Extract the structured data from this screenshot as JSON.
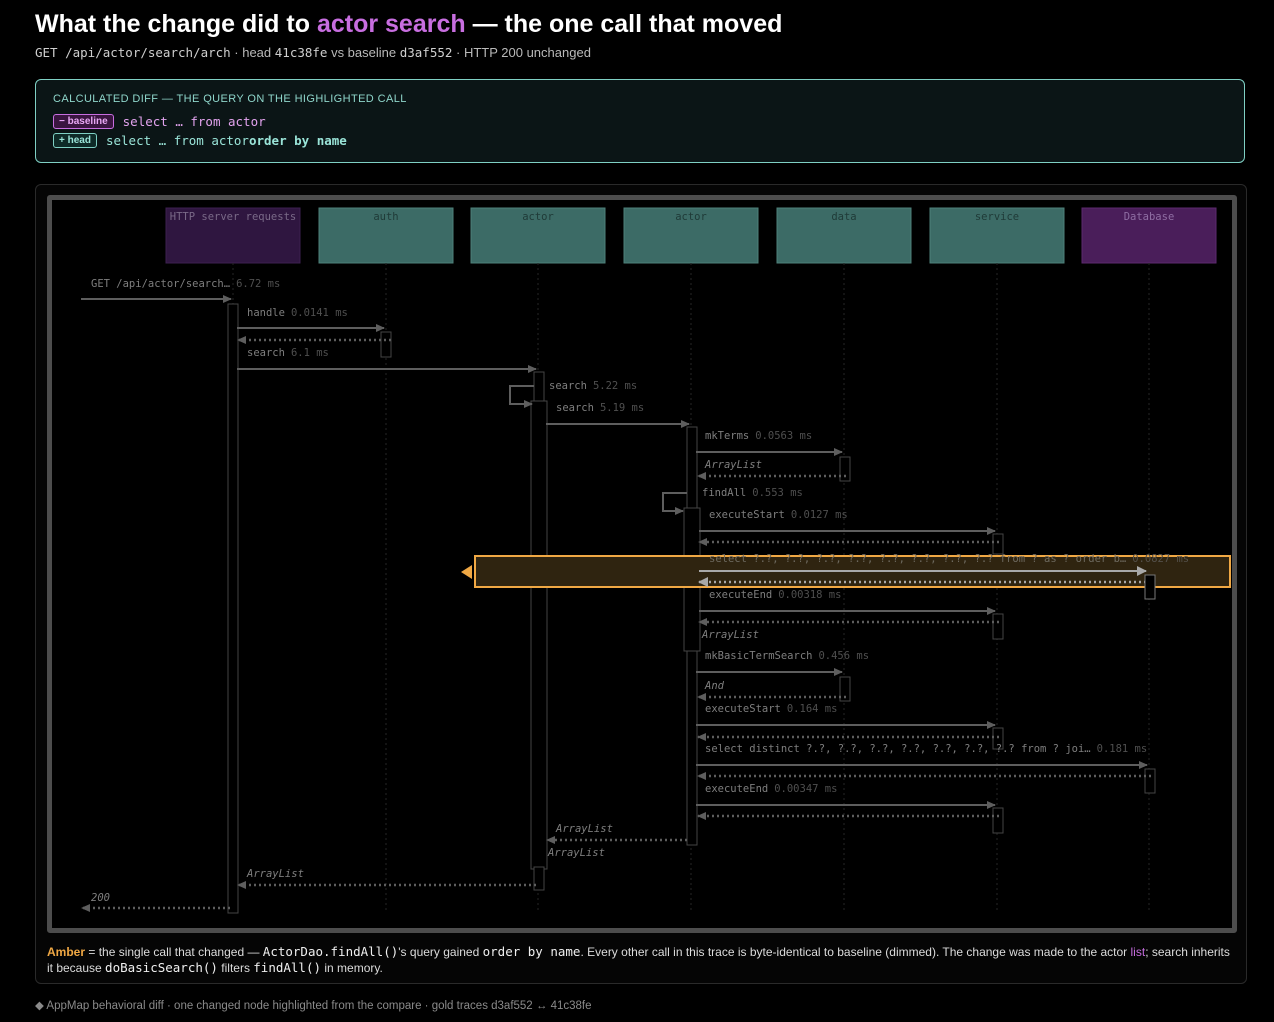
{
  "header": {
    "title_prefix": "What the change did to ",
    "title_highlight": "actor search",
    "title_suffix": " — the one call that moved",
    "sub_route": "GET /api/actor/search/arch",
    "sub_head_label": " · head ",
    "sub_head_sha": "41c38fe",
    "sub_vs_label": " vs baseline ",
    "sub_base_sha": "d3af552",
    "sub_status": " · HTTP 200 unchanged"
  },
  "diff": {
    "heading": "CALCULATED DIFF — THE QUERY ON THE HIGHLIGHTED CALL",
    "baseline_badge": "− baseline",
    "baseline_query": "select … from actor",
    "head_badge": "+ head",
    "head_query_prefix": "select … from actor ",
    "head_query_added": "order by name"
  },
  "diagram": {
    "lifelines": [
      {
        "label": "HTTP server requests",
        "kind": "http"
      },
      {
        "label": "auth",
        "kind": "code"
      },
      {
        "label": "actor",
        "kind": "code"
      },
      {
        "label": "actor",
        "kind": "code"
      },
      {
        "label": "data",
        "kind": "code"
      },
      {
        "label": "service",
        "kind": "code"
      },
      {
        "label": "Database",
        "kind": "db"
      }
    ],
    "messages": [
      {
        "label": "GET /api/actor/search…",
        "time": "6.72 ms"
      },
      {
        "label": "handle",
        "time": "0.0141 ms"
      },
      {
        "label": "search",
        "time": "6.1 ms"
      },
      {
        "label": "search",
        "time": "5.22 ms"
      },
      {
        "label": "search",
        "time": "5.19 ms"
      },
      {
        "label": "mkTerms",
        "time": "0.0563 ms"
      },
      {
        "label": "ArrayList"
      },
      {
        "label": "findAll",
        "time": "0.553 ms"
      },
      {
        "label": "executeStart",
        "time": "0.0127 ms"
      },
      {
        "label": "select ?.?, ?.?, ?.?, ?.?, ?.?, ?.?, ?.?, ?.? from ? as ? order b…",
        "time": "0.0827 ms"
      },
      {
        "label": "executeEnd",
        "time": "0.00318 ms"
      },
      {
        "label": "ArrayList"
      },
      {
        "label": "mkBasicTermSearch",
        "time": "0.456 ms"
      },
      {
        "label": "And"
      },
      {
        "label": "executeStart",
        "time": "0.164 ms"
      },
      {
        "label": "select distinct ?.?, ?.?, ?.?, ?.?, ?.?, ?.?, ?.? from ? joi…",
        "time": "0.181 ms"
      },
      {
        "label": "executeEnd",
        "time": "0.00347 ms"
      },
      {
        "label": "ArrayList"
      },
      {
        "label": "ArrayList"
      },
      {
        "label": "ArrayList"
      },
      {
        "label": "200"
      }
    ]
  },
  "caption": {
    "amber": "Amber",
    "t1": " = the single call that changed — ",
    "code1": "ActorDao.findAll()",
    "t2": "'s query gained ",
    "code2": "order by name",
    "t3": ". Every other call in this trace is byte-identical to baseline (dimmed). The change was made to the actor ",
    "link": "list",
    "t4": "; search inherits it because ",
    "code3": "doBasicSearch()",
    "t5": " filters ",
    "code4": "findAll()",
    "t6": " in memory."
  },
  "footer": {
    "text": "◆ AppMap behavioral diff · one changed node highlighted from the compare · gold traces d3af552 ↔ 41c38fe"
  },
  "colors": {
    "accent_purple": "#c86ee0",
    "accent_teal": "#7fd0c4",
    "highlight_amber": "#f0a844"
  }
}
